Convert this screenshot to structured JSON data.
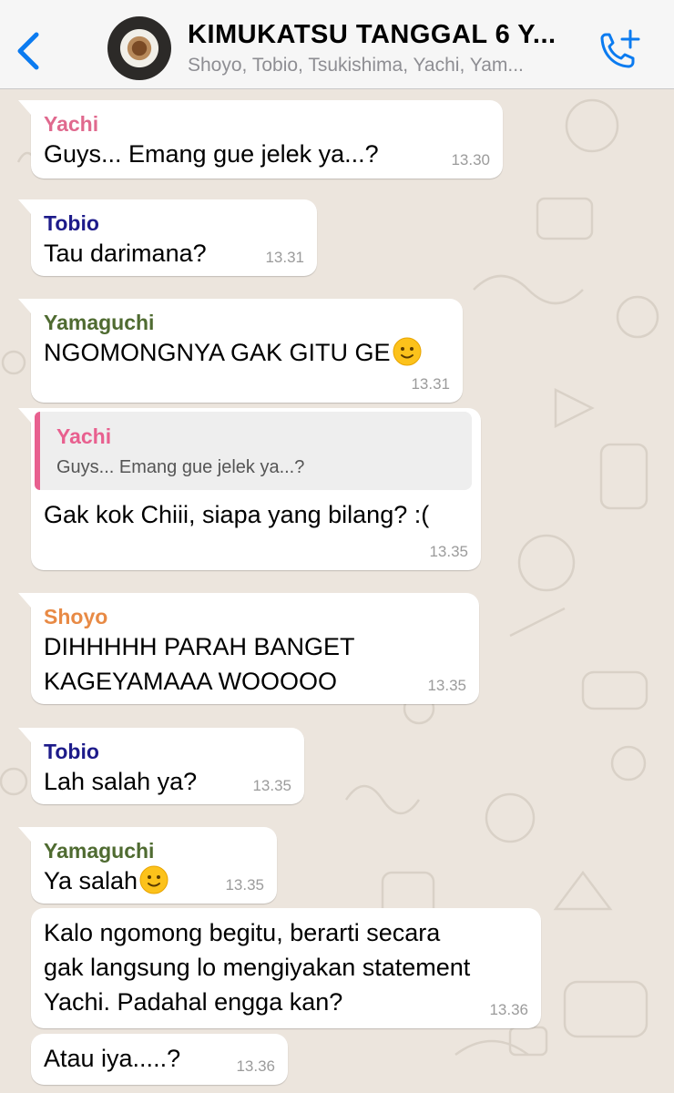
{
  "header": {
    "title": "KIMUKATSU TANGGAL 6 Y...",
    "subtitle": "Shoyo, Tobio, Tsukishima, Yachi, Yam..."
  },
  "colors": {
    "yachi": "#e0698e",
    "tobio": "#1d1b8a",
    "yamaguchi": "#4f6b31",
    "shoyo": "#e88a45",
    "accent": "#0b7bf0"
  },
  "icons": {
    "back": "chevron-left-icon",
    "call": "phone-plus-icon",
    "emoji": "slightly-smiling-face-icon"
  },
  "messages": [
    {
      "sender": "Yachi",
      "text": "Guys... Emang gue jelek ya...?",
      "time": "13.30"
    },
    {
      "sender": "Tobio",
      "text": "Tau darimana?",
      "time": "13.31"
    },
    {
      "sender": "Yamaguchi",
      "text": "NGOMONGNYA GAK GITU GE",
      "time": "13.31"
    },
    {
      "quote_sender": "Yachi",
      "quote_text": "Guys... Emang gue jelek ya...?",
      "text": "Gak kok Chiii, siapa yang bilang? :(",
      "time": "13.35"
    },
    {
      "sender": "Shoyo",
      "text_lines": [
        "DIHHHHH PARAH BANGET",
        "KAGEYAMAAA WOOOOO"
      ],
      "time": "13.35"
    },
    {
      "sender": "Tobio",
      "text": "Lah salah ya?",
      "time": "13.35"
    },
    {
      "sender": "Yamaguchi",
      "text": "Ya salah",
      "time": "13.35"
    },
    {
      "text_lines": [
        "Kalo ngomong begitu, berarti secara",
        "gak langsung lo mengiyakan statement",
        "Yachi. Padahal engga kan?"
      ],
      "time": "13.36"
    },
    {
      "text": "Atau iya.....?",
      "time": "13.36"
    }
  ]
}
